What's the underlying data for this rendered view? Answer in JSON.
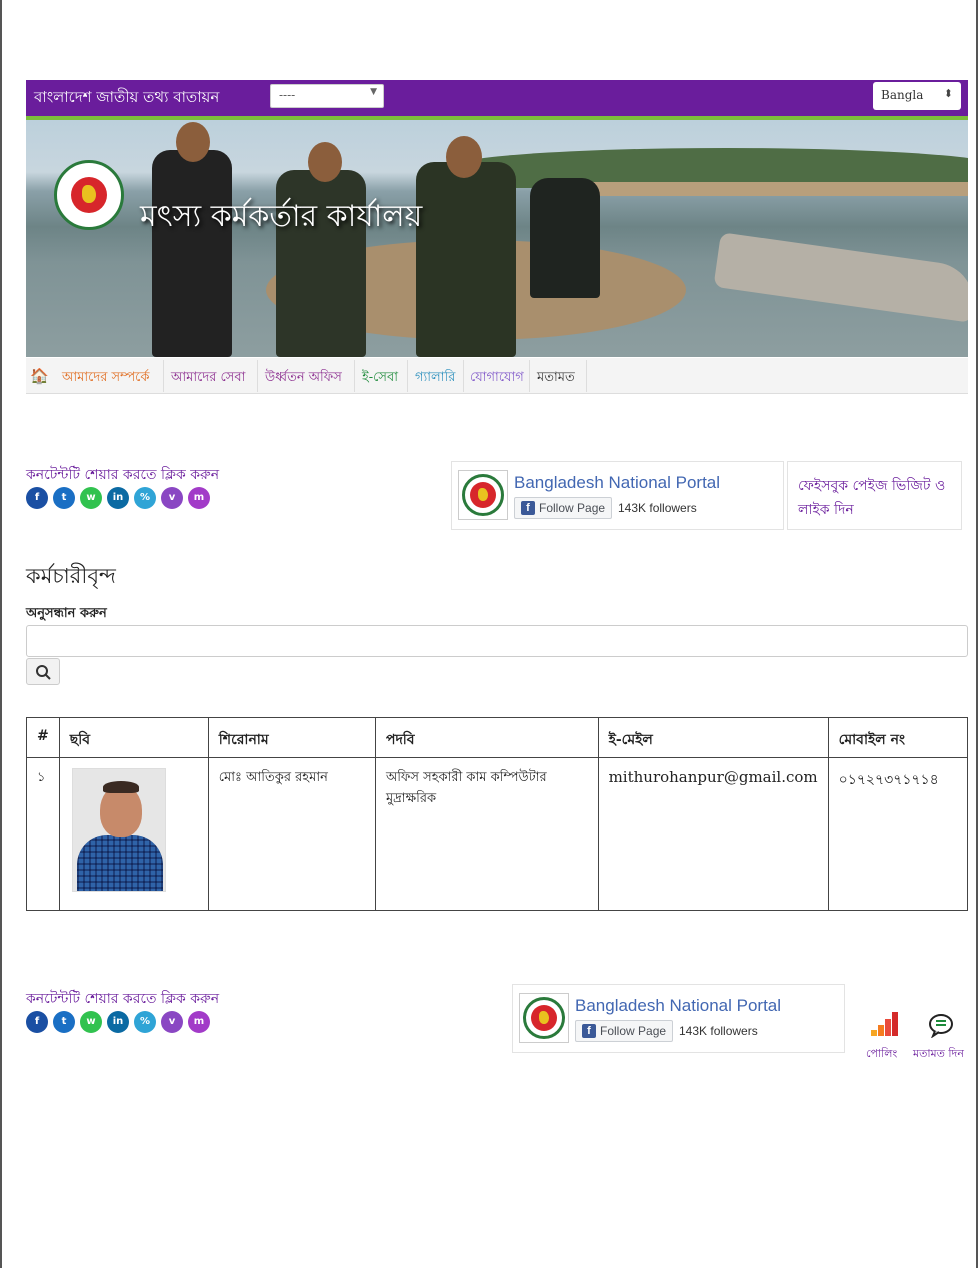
{
  "header": {
    "portal_name": "বাংলাদেশ জাতীয় তথ্য বাতায়ন",
    "portal_select_value": "----",
    "language_select_value": "Bangla",
    "colors": {
      "purple": "#6a1d9c",
      "green": "#7cbd3b"
    }
  },
  "banner": {
    "office_title": "মৎস্য কর্মকর্তার কার্যালয়"
  },
  "nav": {
    "items": [
      {
        "label": "আমাদের সম্পর্কে",
        "color": "#e06b1e"
      },
      {
        "label": "আমাদের সেবা",
        "color": "#8b2d8f"
      },
      {
        "label": "উর্ধ্বতন অফিস",
        "color": "#8b2d8f"
      },
      {
        "label": "ই-সেবা",
        "color": "#1d8a3a"
      },
      {
        "label": "গ্যালারি",
        "color": "#2b8fbd"
      },
      {
        "label": "যোগাযোগ",
        "color": "#7f56c9"
      },
      {
        "label": "মতামত",
        "color": "#333333"
      }
    ]
  },
  "share": {
    "title": "কনটেন্টটি শেয়ার করতে ক্লিক করুন",
    "icons": [
      {
        "name": "facebook-icon",
        "glyph": "f",
        "color": "#1a4fa3"
      },
      {
        "name": "twitter-icon",
        "glyph": "t",
        "color": "#1a6fc4"
      },
      {
        "name": "whatsapp-icon",
        "glyph": "w",
        "color": "#31c24f"
      },
      {
        "name": "linkedin-icon",
        "glyph": "in",
        "color": "#0b6aa3"
      },
      {
        "name": "link-icon",
        "glyph": "%",
        "color": "#2fa4d6"
      },
      {
        "name": "viber-icon",
        "glyph": "v",
        "color": "#8a47c3"
      },
      {
        "name": "messenger-icon",
        "glyph": "m",
        "color": "#a23bc8"
      }
    ]
  },
  "facebook": {
    "page_name": "Bangladesh National Portal",
    "follow_label": "Follow Page",
    "followers": "143K followers",
    "visit_text": "ফেইসবুক পেইজ ভিজিট ও লাইক দিন"
  },
  "main": {
    "heading": "কর্মচারীবৃন্দ",
    "search_label": "অনুসন্ধান করুন",
    "search_placeholder": "",
    "table": {
      "headers": [
        "#",
        "ছবি",
        "শিরোনাম",
        "পদবি",
        "ই-মেইল",
        "মোবাইল নং"
      ],
      "rows": [
        {
          "index": "১",
          "name": "মোঃ আতিকুর রহমান",
          "designation": "অফিস সহকারী কাম কম্পিউটার মুদ্রাক্ষরিক",
          "email": "mithurohanpur@gmail.com",
          "mobile": "০১৭২৭৩৭১৭১৪"
        }
      ]
    }
  },
  "footer": {
    "poll_label": "পোলিং",
    "feedback_label": "মতামত দিন"
  }
}
